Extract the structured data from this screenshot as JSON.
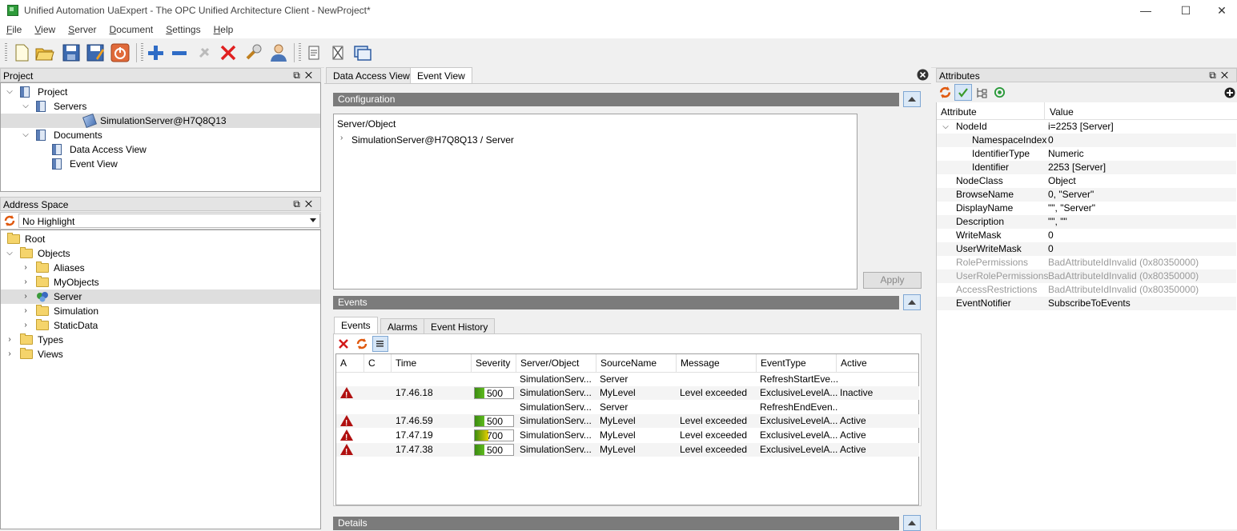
{
  "window": {
    "title": "Unified Automation UaExpert - The OPC Unified Architecture Client - NewProject*",
    "minimize": "—",
    "maximize": "☐",
    "close": "✕"
  },
  "menu": [
    "File",
    "View",
    "Server",
    "Document",
    "Settings",
    "Help"
  ],
  "toolbar": {
    "icons": [
      "new-document-icon",
      "open-folder-icon",
      "save-icon",
      "save-as-icon",
      "power-icon",
      "add-server-icon",
      "remove-server-icon",
      "connect-icon",
      "disconnect-icon",
      "settings-wrench-icon",
      "user-icon",
      "report-icon",
      "clear-icon",
      "window-icon"
    ]
  },
  "project": {
    "title": "Project",
    "tree": [
      {
        "label": "Project",
        "level": 0,
        "expanded": true,
        "icon": "doc"
      },
      {
        "label": "Servers",
        "level": 1,
        "expanded": true,
        "icon": "doc"
      },
      {
        "label": "SimulationServer@H7Q8Q13",
        "level": 2,
        "icon": "server",
        "selected": true
      },
      {
        "label": "Documents",
        "level": 1,
        "expanded": true,
        "icon": "doc"
      },
      {
        "label": "Data Access View",
        "level": 2,
        "icon": "doc"
      },
      {
        "label": "Event View",
        "level": 2,
        "icon": "doc"
      }
    ]
  },
  "address_space": {
    "title": "Address Space",
    "highlight": "No Highlight",
    "tree": [
      {
        "label": "Root",
        "level": 0
      },
      {
        "label": "Objects",
        "level": 0,
        "expanded": true
      },
      {
        "label": "Aliases",
        "level": 1
      },
      {
        "label": "MyObjects",
        "level": 1
      },
      {
        "label": "Server",
        "level": 1,
        "selected": true,
        "icon": "server"
      },
      {
        "label": "Simulation",
        "level": 1
      },
      {
        "label": "StaticData",
        "level": 1
      },
      {
        "label": "Types",
        "level": 0
      },
      {
        "label": "Views",
        "level": 0
      }
    ]
  },
  "center": {
    "tabs": [
      "Data Access View",
      "Event View"
    ],
    "active_tab": "Event View",
    "configuration": {
      "title": "Configuration",
      "column": "Server/Object",
      "item": "SimulationServer@H7Q8Q13 / Server",
      "apply": "Apply"
    },
    "events_section": {
      "title": "Events",
      "tabs": [
        "Events",
        "Alarms",
        "Event History"
      ],
      "columns": [
        "A",
        "C",
        "Time",
        "Severity",
        "Server/Object",
        "SourceName",
        "Message",
        "EventType",
        "Active"
      ],
      "rows": [
        {
          "a": "",
          "c": "",
          "time": "",
          "severity": "",
          "server": "SimulationServ...",
          "source": "Server",
          "message": "",
          "type": "RefreshStartEve...",
          "active": "",
          "warn": false
        },
        {
          "a": "",
          "c": "",
          "time": "17.46.18",
          "severity": "500",
          "server": "SimulationServ...",
          "source": "MyLevel",
          "message": "Level exceeded",
          "type": "ExclusiveLevelA...",
          "active": "Inactive",
          "warn": true
        },
        {
          "a": "",
          "c": "",
          "time": "",
          "severity": "",
          "server": "SimulationServ...",
          "source": "Server",
          "message": "",
          "type": "RefreshEndEven...",
          "active": "",
          "warn": false
        },
        {
          "a": "",
          "c": "",
          "time": "17.46.59",
          "severity": "500",
          "server": "SimulationServ...",
          "source": "MyLevel",
          "message": "Level exceeded",
          "type": "ExclusiveLevelA...",
          "active": "Active",
          "warn": true
        },
        {
          "a": "",
          "c": "",
          "time": "17.47.19",
          "severity": "700",
          "server": "SimulationServ...",
          "source": "MyLevel",
          "message": "Level exceeded",
          "type": "ExclusiveLevelA...",
          "active": "Active",
          "warn": true
        },
        {
          "a": "",
          "c": "",
          "time": "17.47.38",
          "severity": "500",
          "server": "SimulationServ...",
          "source": "MyLevel",
          "message": "Level exceeded",
          "type": "ExclusiveLevelA...",
          "active": "Active",
          "warn": true
        }
      ]
    },
    "details": {
      "title": "Details"
    }
  },
  "attributes": {
    "title": "Attributes",
    "columns": [
      "Attribute",
      "Value"
    ],
    "rows": [
      {
        "name": "NodeId",
        "value": "i=2253 [Server]",
        "level": 0,
        "expanded": true
      },
      {
        "name": "NamespaceIndex",
        "value": "0",
        "level": 1
      },
      {
        "name": "IdentifierType",
        "value": "Numeric",
        "level": 1
      },
      {
        "name": "Identifier",
        "value": "2253 [Server]",
        "level": 1
      },
      {
        "name": "NodeClass",
        "value": "Object",
        "level": 0
      },
      {
        "name": "BrowseName",
        "value": "0, \"Server\"",
        "level": 0
      },
      {
        "name": "DisplayName",
        "value": "\"\", \"Server\"",
        "level": 0
      },
      {
        "name": "Description",
        "value": "\"\", \"\"",
        "level": 0
      },
      {
        "name": "WriteMask",
        "value": "0",
        "level": 0
      },
      {
        "name": "UserWriteMask",
        "value": "0",
        "level": 0
      },
      {
        "name": "RolePermissions",
        "value": "BadAttributeIdInvalid (0x80350000)",
        "level": 0,
        "dim": true
      },
      {
        "name": "UserRolePermissions",
        "value": "BadAttributeIdInvalid (0x80350000)",
        "level": 0,
        "dim": true
      },
      {
        "name": "AccessRestrictions",
        "value": "BadAttributeIdInvalid (0x80350000)",
        "level": 0,
        "dim": true
      },
      {
        "name": "EventNotifier",
        "value": "SubscribeToEvents",
        "level": 0
      }
    ]
  },
  "colors": {
    "section_bar": "#7b7b7b",
    "warning": "#b01010",
    "severity_fill_500": "#5fba1f",
    "severity_fill_700": "#e8d000"
  }
}
